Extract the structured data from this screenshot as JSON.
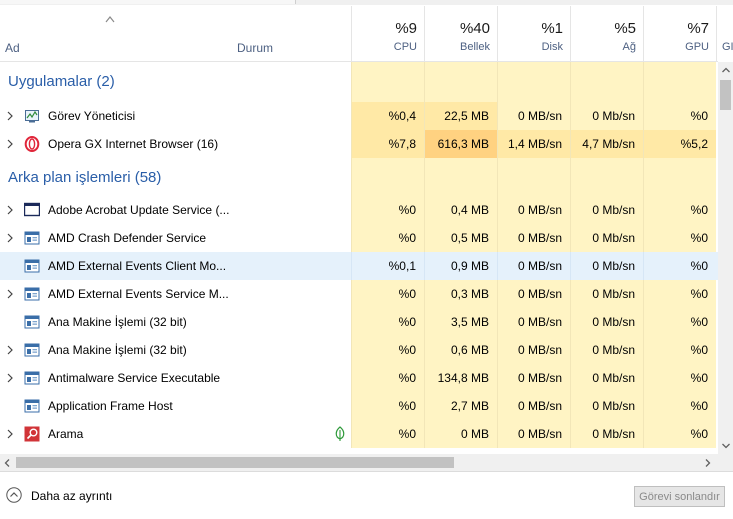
{
  "columns": {
    "name": {
      "label": "Ad"
    },
    "status": {
      "label": "Durum"
    },
    "cpu": {
      "pct": "%9",
      "label": "CPU"
    },
    "memory": {
      "pct": "%40",
      "label": "Bellek"
    },
    "disk": {
      "pct": "%1",
      "label": "Disk"
    },
    "network": {
      "pct": "%5",
      "label": "Ağ"
    },
    "gpu": {
      "pct": "%7",
      "label": "GPU"
    },
    "gpu_engine": {
      "label": "GI"
    }
  },
  "groups": {
    "apps": {
      "label": "Uygulamalar (2)"
    },
    "background": {
      "label": "Arka plan işlemleri (58)"
    }
  },
  "apps": [
    {
      "name": "Görev Yöneticisi",
      "icon": "task-manager-icon",
      "expandable": true,
      "cpu": "%0,4",
      "memory": "22,5 MB",
      "disk": "0 MB/sn",
      "network": "0 Mb/sn",
      "gpu": "%0"
    },
    {
      "name": "Opera GX Internet Browser (16)",
      "icon": "opera-icon",
      "expandable": true,
      "cpu": "%7,8",
      "memory": "616,3 MB",
      "disk": "1,4 MB/sn",
      "network": "4,7 Mb/sn",
      "gpu": "%5,2"
    }
  ],
  "background": [
    {
      "name": "Adobe Acrobat Update Service (...",
      "icon": "window-icon",
      "expandable": true,
      "cpu": "%0",
      "memory": "0,4 MB",
      "disk": "0 MB/sn",
      "network": "0 Mb/sn",
      "gpu": "%0"
    },
    {
      "name": "AMD Crash Defender Service",
      "icon": "service-icon",
      "expandable": true,
      "cpu": "%0",
      "memory": "0,5 MB",
      "disk": "0 MB/sn",
      "network": "0 Mb/sn",
      "gpu": "%0"
    },
    {
      "name": "AMD External Events Client Mo...",
      "icon": "service-icon",
      "expandable": false,
      "selected": true,
      "cpu": "%0,1",
      "memory": "0,9 MB",
      "disk": "0 MB/sn",
      "network": "0 Mb/sn",
      "gpu": "%0"
    },
    {
      "name": "AMD External Events Service M...",
      "icon": "service-icon",
      "expandable": true,
      "cpu": "%0",
      "memory": "0,3 MB",
      "disk": "0 MB/sn",
      "network": "0 Mb/sn",
      "gpu": "%0"
    },
    {
      "name": "Ana Makine İşlemi (32 bit)",
      "icon": "service-icon",
      "expandable": false,
      "cpu": "%0",
      "memory": "3,5 MB",
      "disk": "0 MB/sn",
      "network": "0 Mb/sn",
      "gpu": "%0"
    },
    {
      "name": "Ana Makine İşlemi (32 bit)",
      "icon": "service-icon",
      "expandable": true,
      "cpu": "%0",
      "memory": "0,6 MB",
      "disk": "0 MB/sn",
      "network": "0 Mb/sn",
      "gpu": "%0"
    },
    {
      "name": "Antimalware Service Executable",
      "icon": "service-icon",
      "expandable": true,
      "cpu": "%0",
      "memory": "134,8 MB",
      "disk": "0 MB/sn",
      "network": "0 Mb/sn",
      "gpu": "%0"
    },
    {
      "name": "Application Frame Host",
      "icon": "service-icon",
      "expandable": false,
      "cpu": "%0",
      "memory": "2,7 MB",
      "disk": "0 MB/sn",
      "network": "0 Mb/sn",
      "gpu": "%0"
    },
    {
      "name": "Arama",
      "icon": "search-app-icon",
      "expandable": true,
      "leaf": true,
      "cpu": "%0",
      "memory": "0 MB",
      "disk": "0 MB/sn",
      "network": "0 Mb/sn",
      "gpu": "%0"
    }
  ],
  "footer": {
    "less_details": "Daha az ayrıntı",
    "end_task": "Görevi sonlandır"
  },
  "colors": {
    "heat_light": "#fff4c4",
    "heat_medium": "#ffe9a6",
    "heat_high": "#ffd281",
    "group_blue": "#2a5ea8",
    "selected": "#e5f1fb"
  }
}
